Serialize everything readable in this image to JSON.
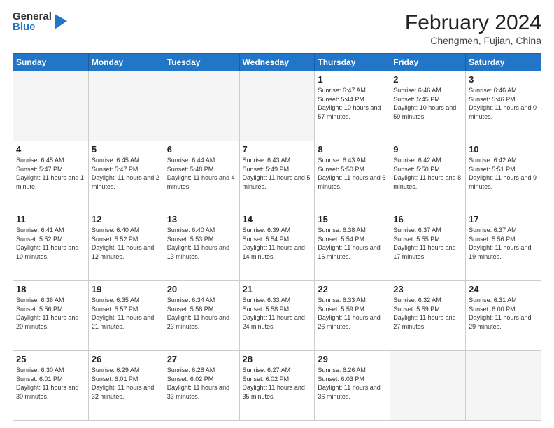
{
  "header": {
    "logo_general": "General",
    "logo_blue": "Blue",
    "title": "February 2024",
    "subtitle": "Chengmen, Fujian, China"
  },
  "weekdays": [
    "Sunday",
    "Monday",
    "Tuesday",
    "Wednesday",
    "Thursday",
    "Friday",
    "Saturday"
  ],
  "weeks": [
    [
      {
        "day": "",
        "info": ""
      },
      {
        "day": "",
        "info": ""
      },
      {
        "day": "",
        "info": ""
      },
      {
        "day": "",
        "info": ""
      },
      {
        "day": "1",
        "info": "Sunrise: 6:47 AM\nSunset: 5:44 PM\nDaylight: 10 hours and 57 minutes."
      },
      {
        "day": "2",
        "info": "Sunrise: 6:46 AM\nSunset: 5:45 PM\nDaylight: 10 hours and 59 minutes."
      },
      {
        "day": "3",
        "info": "Sunrise: 6:46 AM\nSunset: 5:46 PM\nDaylight: 11 hours and 0 minutes."
      }
    ],
    [
      {
        "day": "4",
        "info": "Sunrise: 6:45 AM\nSunset: 5:47 PM\nDaylight: 11 hours and 1 minute."
      },
      {
        "day": "5",
        "info": "Sunrise: 6:45 AM\nSunset: 5:47 PM\nDaylight: 11 hours and 2 minutes."
      },
      {
        "day": "6",
        "info": "Sunrise: 6:44 AM\nSunset: 5:48 PM\nDaylight: 11 hours and 4 minutes."
      },
      {
        "day": "7",
        "info": "Sunrise: 6:43 AM\nSunset: 5:49 PM\nDaylight: 11 hours and 5 minutes."
      },
      {
        "day": "8",
        "info": "Sunrise: 6:43 AM\nSunset: 5:50 PM\nDaylight: 11 hours and 6 minutes."
      },
      {
        "day": "9",
        "info": "Sunrise: 6:42 AM\nSunset: 5:50 PM\nDaylight: 11 hours and 8 minutes."
      },
      {
        "day": "10",
        "info": "Sunrise: 6:42 AM\nSunset: 5:51 PM\nDaylight: 11 hours and 9 minutes."
      }
    ],
    [
      {
        "day": "11",
        "info": "Sunrise: 6:41 AM\nSunset: 5:52 PM\nDaylight: 11 hours and 10 minutes."
      },
      {
        "day": "12",
        "info": "Sunrise: 6:40 AM\nSunset: 5:52 PM\nDaylight: 11 hours and 12 minutes."
      },
      {
        "day": "13",
        "info": "Sunrise: 6:40 AM\nSunset: 5:53 PM\nDaylight: 11 hours and 13 minutes."
      },
      {
        "day": "14",
        "info": "Sunrise: 6:39 AM\nSunset: 5:54 PM\nDaylight: 11 hours and 14 minutes."
      },
      {
        "day": "15",
        "info": "Sunrise: 6:38 AM\nSunset: 5:54 PM\nDaylight: 11 hours and 16 minutes."
      },
      {
        "day": "16",
        "info": "Sunrise: 6:37 AM\nSunset: 5:55 PM\nDaylight: 11 hours and 17 minutes."
      },
      {
        "day": "17",
        "info": "Sunrise: 6:37 AM\nSunset: 5:56 PM\nDaylight: 11 hours and 19 minutes."
      }
    ],
    [
      {
        "day": "18",
        "info": "Sunrise: 6:36 AM\nSunset: 5:56 PM\nDaylight: 11 hours and 20 minutes."
      },
      {
        "day": "19",
        "info": "Sunrise: 6:35 AM\nSunset: 5:57 PM\nDaylight: 11 hours and 21 minutes."
      },
      {
        "day": "20",
        "info": "Sunrise: 6:34 AM\nSunset: 5:58 PM\nDaylight: 11 hours and 23 minutes."
      },
      {
        "day": "21",
        "info": "Sunrise: 6:33 AM\nSunset: 5:58 PM\nDaylight: 11 hours and 24 minutes."
      },
      {
        "day": "22",
        "info": "Sunrise: 6:33 AM\nSunset: 5:59 PM\nDaylight: 11 hours and 26 minutes."
      },
      {
        "day": "23",
        "info": "Sunrise: 6:32 AM\nSunset: 5:59 PM\nDaylight: 11 hours and 27 minutes."
      },
      {
        "day": "24",
        "info": "Sunrise: 6:31 AM\nSunset: 6:00 PM\nDaylight: 11 hours and 29 minutes."
      }
    ],
    [
      {
        "day": "25",
        "info": "Sunrise: 6:30 AM\nSunset: 6:01 PM\nDaylight: 11 hours and 30 minutes."
      },
      {
        "day": "26",
        "info": "Sunrise: 6:29 AM\nSunset: 6:01 PM\nDaylight: 11 hours and 32 minutes."
      },
      {
        "day": "27",
        "info": "Sunrise: 6:28 AM\nSunset: 6:02 PM\nDaylight: 11 hours and 33 minutes."
      },
      {
        "day": "28",
        "info": "Sunrise: 6:27 AM\nSunset: 6:02 PM\nDaylight: 11 hours and 35 minutes."
      },
      {
        "day": "29",
        "info": "Sunrise: 6:26 AM\nSunset: 6:03 PM\nDaylight: 11 hours and 36 minutes."
      },
      {
        "day": "",
        "info": ""
      },
      {
        "day": "",
        "info": ""
      }
    ]
  ]
}
